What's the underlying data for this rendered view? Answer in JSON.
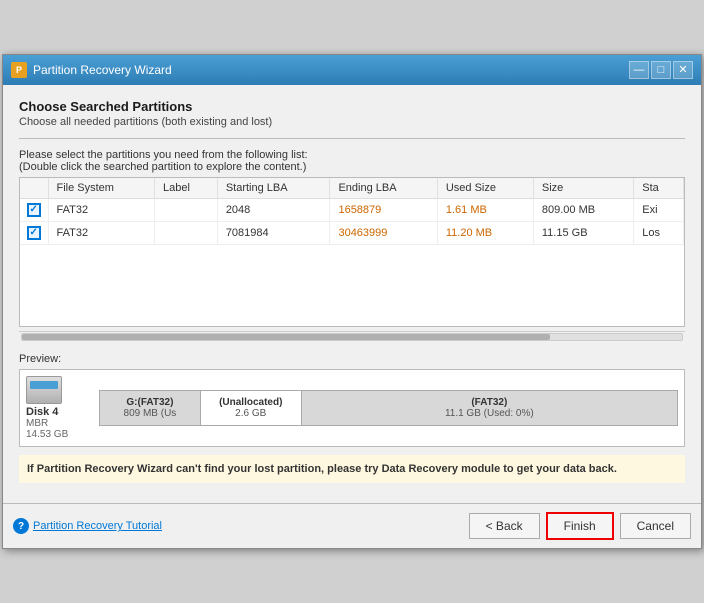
{
  "window": {
    "title": "Partition Recovery Wizard",
    "icon": "P",
    "minimize_label": "—",
    "maximize_label": "□",
    "close_label": "✕"
  },
  "header": {
    "title": "Choose Searched Partitions",
    "subtitle": "Choose all needed partitions (both existing and lost)"
  },
  "instructions": {
    "line1": "Please select the partitions you need from the following list:",
    "line2": "(Double click the searched partition to explore the content.)"
  },
  "table": {
    "columns": [
      "",
      "File System",
      "Label",
      "Starting LBA",
      "Ending LBA",
      "Used Size",
      "Size",
      "Sta"
    ],
    "rows": [
      {
        "checked": true,
        "filesystem": "FAT32",
        "label": "",
        "starting_lba": "2048",
        "ending_lba": "1658879",
        "used_size": "1.61 MB",
        "size": "809.00 MB",
        "status": "Exi"
      },
      {
        "checked": true,
        "filesystem": "FAT32",
        "label": "",
        "starting_lba": "7081984",
        "ending_lba": "30463999",
        "used_size": "11.20 MB",
        "size": "11.15 GB",
        "status": "Los"
      }
    ]
  },
  "preview": {
    "label": "Preview:",
    "disk_name": "Disk 4",
    "disk_type": "MBR",
    "disk_size": "14.53 GB",
    "partitions": [
      {
        "label": "G:(FAT32)",
        "size": "809 MB (Us",
        "style": "gray",
        "flex": 1
      },
      {
        "label": "(Unallocated)",
        "size": "2.6 GB",
        "style": "white",
        "flex": 1
      },
      {
        "label": "(FAT32)",
        "size": "11.1 GB (Used: 0%)",
        "style": "gray",
        "flex": 4
      }
    ]
  },
  "warning": {
    "text_bold": "If Partition Recovery Wizard can't find your lost partition, please try Data Recovery module to get your data back."
  },
  "bottom": {
    "help_icon": "?",
    "tutorial_link": "Partition Recovery Tutorial",
    "back_button": "< Back",
    "finish_button": "Finish",
    "cancel_button": "Cancel"
  }
}
